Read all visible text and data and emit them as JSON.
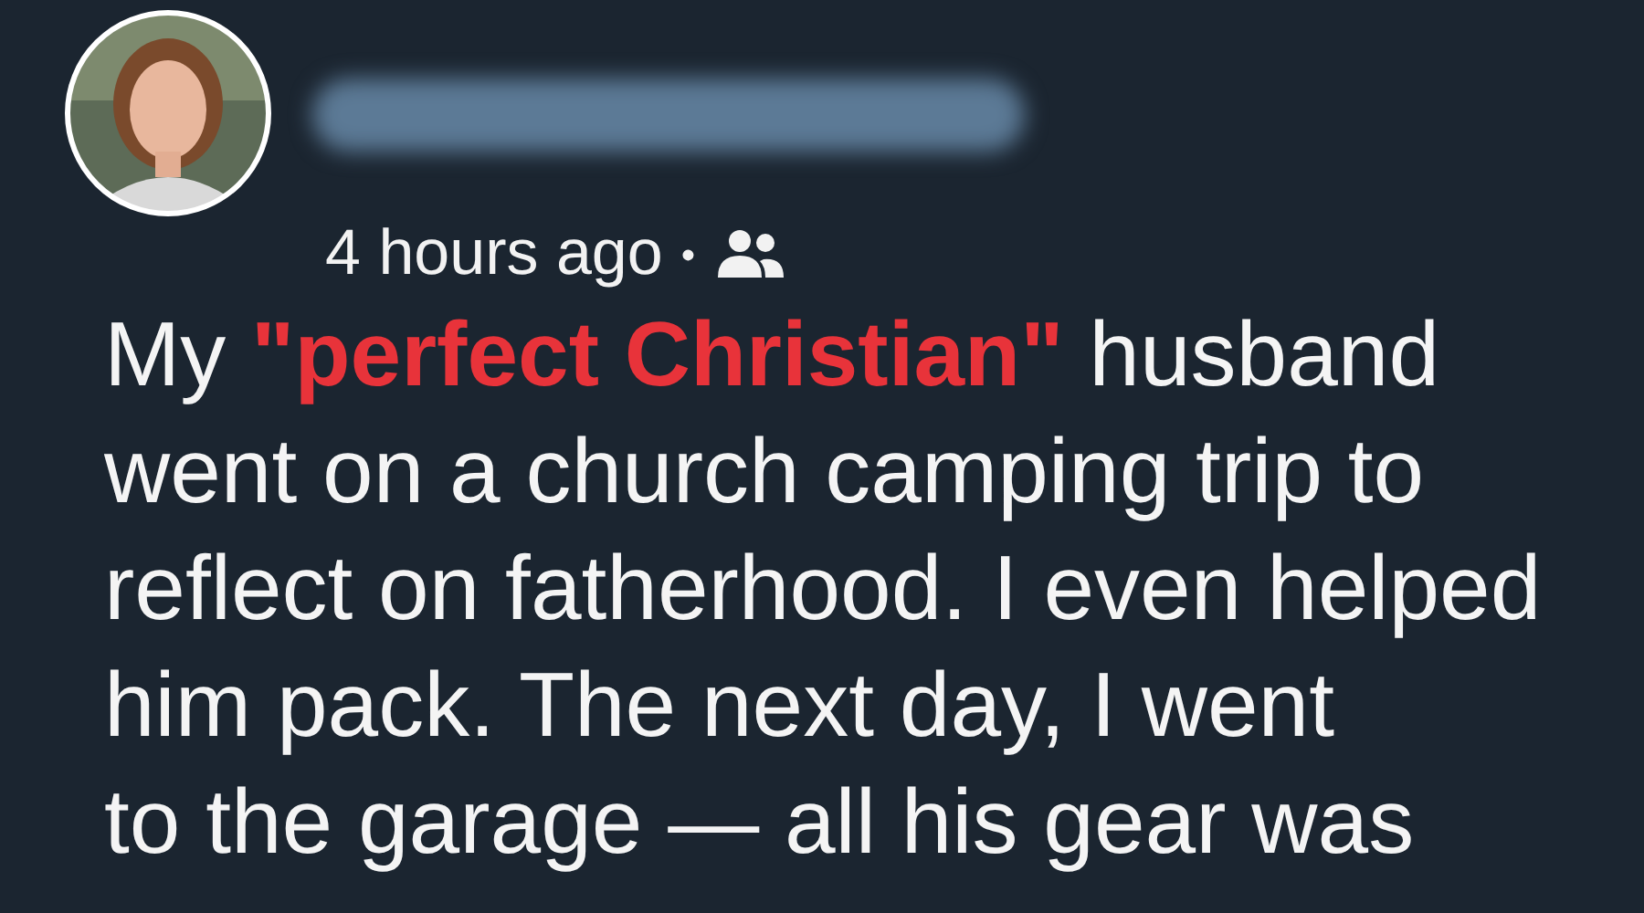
{
  "post": {
    "time": "4 hours ago",
    "separator": "•",
    "audience_icon": true,
    "text_lines": [
      [
        {
          "text": "My ",
          "highlight": false
        },
        {
          "text": "\"perfect Christian\"",
          "highlight": true
        },
        {
          "text": " husband",
          "highlight": false
        }
      ],
      [
        {
          "text": "went on a church camping trip to",
          "highlight": false
        }
      ],
      [
        {
          "text": "reflect on fatherhood. I even helped",
          "highlight": false
        }
      ],
      [
        {
          "text": "him pack. The next day, I went",
          "highlight": false
        }
      ],
      [
        {
          "text": "to the garage — all his gear was",
          "highlight": false
        }
      ]
    ]
  }
}
